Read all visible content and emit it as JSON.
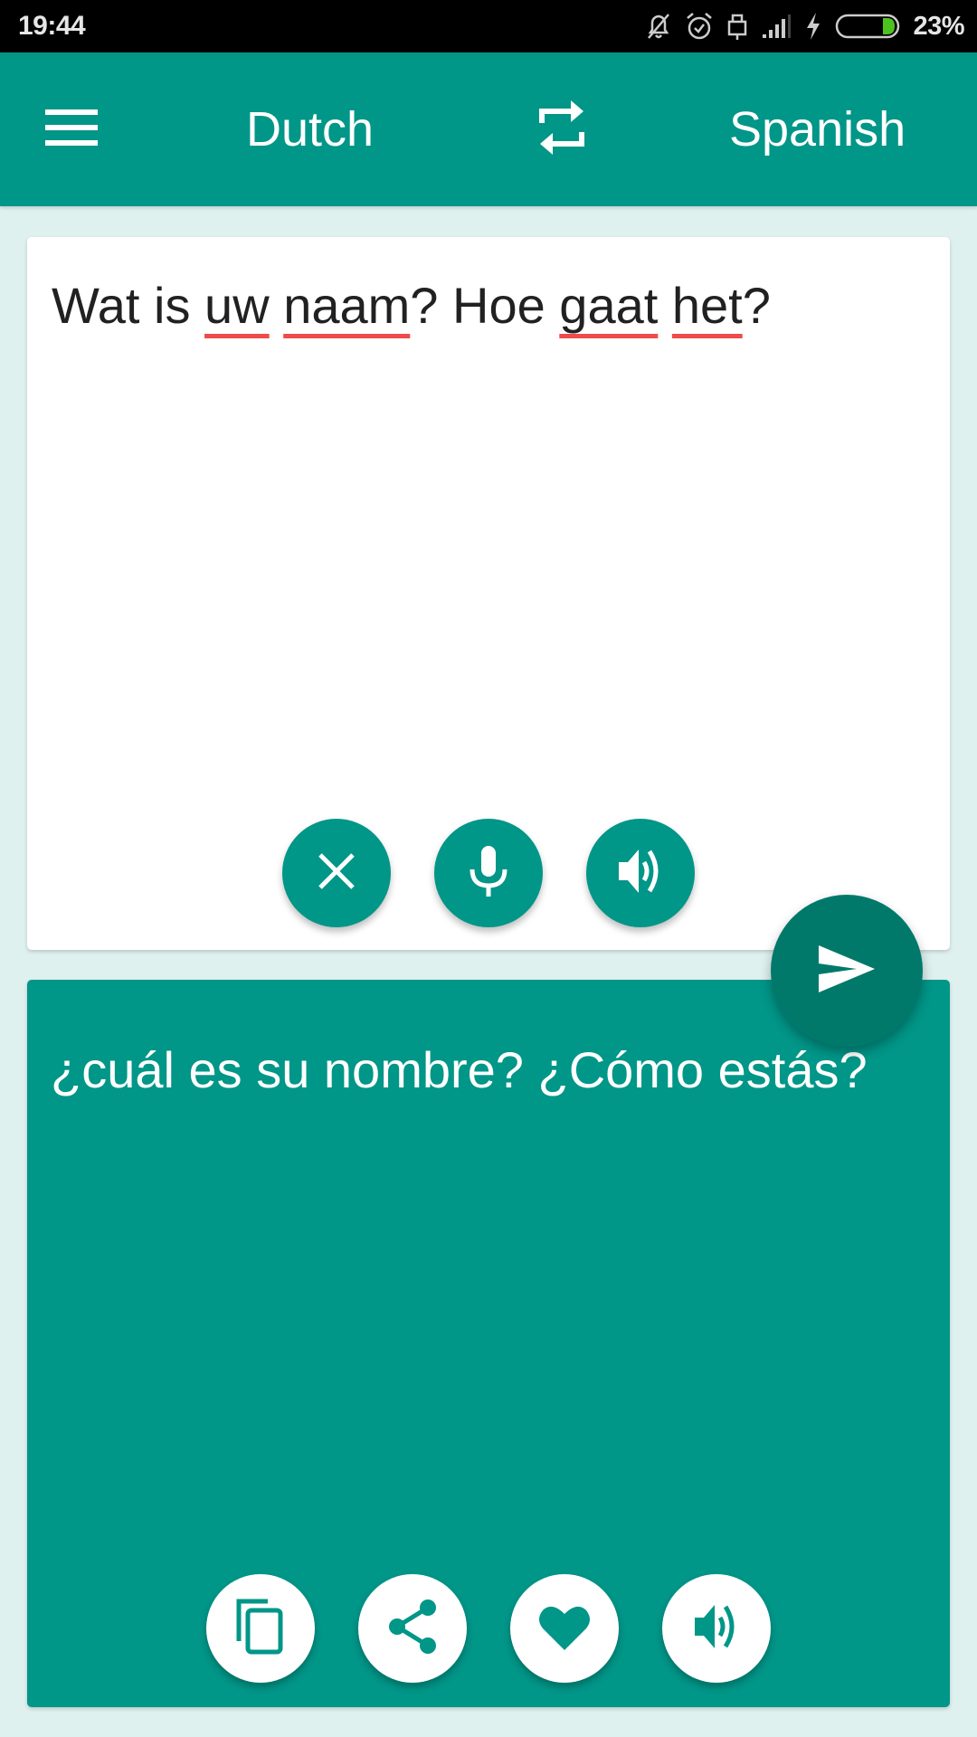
{
  "status_bar": {
    "time": "19:44",
    "icons": [
      "notifications-off-icon",
      "alarm-icon",
      "usb-lock-icon",
      "signal-icon",
      "charging-icon",
      "battery-icon"
    ],
    "battery_percent": "23%",
    "battery_level": 0.23,
    "battery_fill_color": "#4cc21f"
  },
  "app_bar": {
    "menu_icon": "hamburger-menu-icon",
    "source_language": "Dutch",
    "swap_icon": "swap-languages-icon",
    "target_language": "Spanish",
    "color": "#009688"
  },
  "input": {
    "segments": [
      {
        "text": "Wat is ",
        "misspelled": false
      },
      {
        "text": "uw",
        "misspelled": true
      },
      {
        "text": " ",
        "misspelled": false
      },
      {
        "text": "naam",
        "misspelled": true
      },
      {
        "text": "? Hoe ",
        "misspelled": false
      },
      {
        "text": "gaat",
        "misspelled": true
      },
      {
        "text": " ",
        "misspelled": false
      },
      {
        "text": "het",
        "misspelled": true
      },
      {
        "text": "?",
        "misspelled": false
      }
    ],
    "buttons": [
      {
        "name": "clear",
        "icon": "close-icon"
      },
      {
        "name": "voice-input",
        "icon": "microphone-icon"
      },
      {
        "name": "speak",
        "icon": "volume-icon"
      }
    ]
  },
  "translate_button": {
    "icon": "send-icon",
    "color": "#00796b"
  },
  "output": {
    "text": "¿cuál es su nombre? ¿Cómo estás?",
    "buttons": [
      {
        "name": "copy",
        "icon": "copy-icon"
      },
      {
        "name": "share",
        "icon": "share-icon"
      },
      {
        "name": "favorite",
        "icon": "heart-icon"
      },
      {
        "name": "speak",
        "icon": "volume-icon"
      }
    ]
  },
  "colors": {
    "primary": "#009688",
    "primary_dark": "#00796b",
    "background": "#dff1ef",
    "misspelling_underline": "#ef4b4b"
  }
}
